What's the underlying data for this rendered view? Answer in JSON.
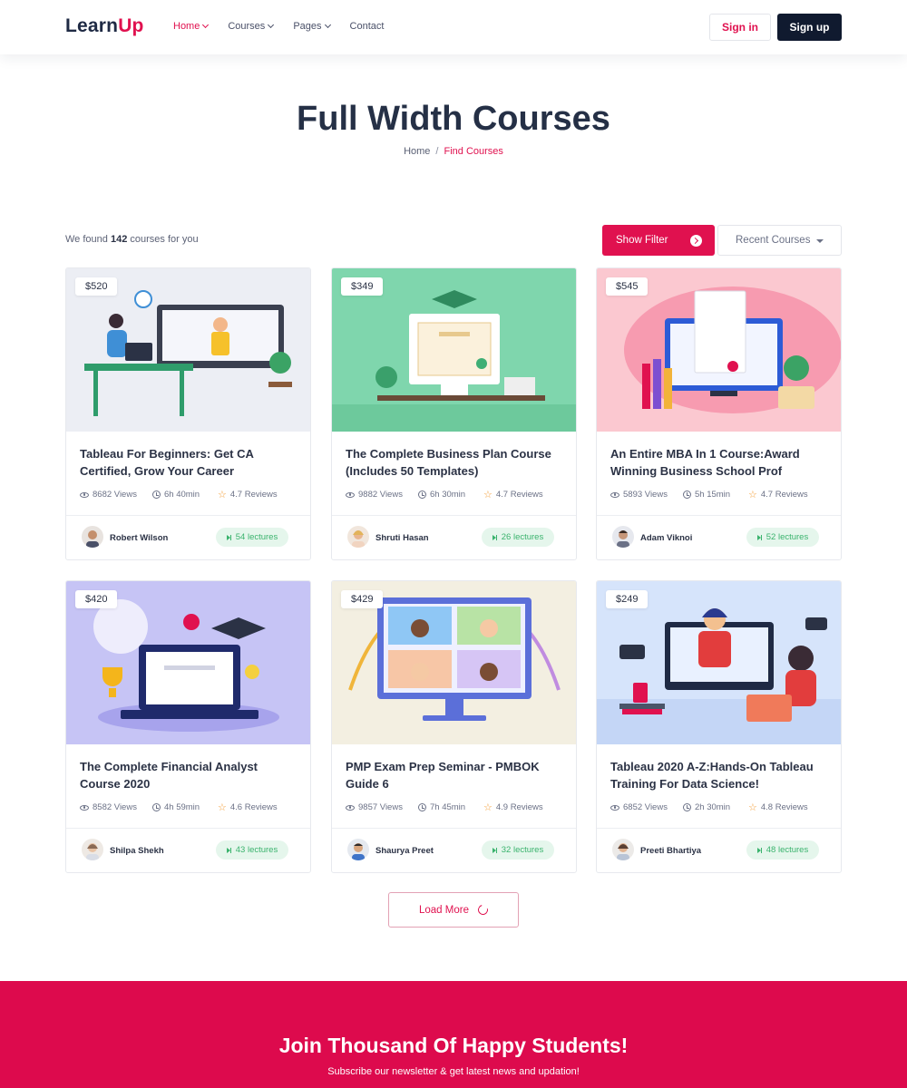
{
  "header": {
    "logo": {
      "part1": "Learn",
      "part2": "Up"
    },
    "nav": [
      {
        "label": "Home",
        "active": true,
        "dropdown": true
      },
      {
        "label": "Courses",
        "active": false,
        "dropdown": true
      },
      {
        "label": "Pages",
        "active": false,
        "dropdown": true
      },
      {
        "label": "Contact",
        "active": false,
        "dropdown": false
      }
    ],
    "signin_label": "Sign in",
    "signup_label": "Sign up"
  },
  "hero": {
    "title": "Full Width Courses",
    "breadcrumb": {
      "home": "Home",
      "separator": "/",
      "current": "Find Courses"
    }
  },
  "toolbar": {
    "found_prefix": "We found",
    "found_count": "142",
    "found_suffix": "courses for you",
    "filter_label": "Show Filter",
    "sort_label": "Recent Courses"
  },
  "courses": [
    {
      "price": "$520",
      "title": "Tableau For Beginners: Get CA Certified, Grow Your Career",
      "views": "8682 Views",
      "duration": "6h 40min",
      "reviews": "4.7 Reviews",
      "author": "Robert Wilson",
      "lectures": "54 lectures",
      "theme": "#eceef4"
    },
    {
      "price": "$349",
      "title": "The Complete Business Plan Course (Includes 50 Templates)",
      "views": "9882 Views",
      "duration": "6h 30min",
      "reviews": "4.7 Reviews",
      "author": "Shruti Hasan",
      "lectures": "26 lectures",
      "theme": "#7fd6ad"
    },
    {
      "price": "$545",
      "title": "An Entire MBA In 1 Course:Award Winning Business School Prof",
      "views": "5893 Views",
      "duration": "5h 15min",
      "reviews": "4.7 Reviews",
      "author": "Adam Viknoi",
      "lectures": "52 lectures",
      "theme": "#fbc8d0"
    },
    {
      "price": "$420",
      "title": "The Complete Financial Analyst Course 2020",
      "views": "8582 Views",
      "duration": "4h 59min",
      "reviews": "4.6 Reviews",
      "author": "Shilpa Shekh",
      "lectures": "43 lectures",
      "theme": "#c6c4f5"
    },
    {
      "price": "$429",
      "title": "PMP Exam Prep Seminar - PMBOK Guide 6",
      "views": "9857 Views",
      "duration": "7h 45min",
      "reviews": "4.9 Reviews",
      "author": "Shaurya Preet",
      "lectures": "32 lectures",
      "theme": "#f3efe1"
    },
    {
      "price": "$249",
      "title": "Tableau 2020 A-Z:Hands-On Tableau Training For Data Science!",
      "views": "6852 Views",
      "duration": "2h 30min",
      "reviews": "4.8 Reviews",
      "author": "Preeti Bhartiya",
      "lectures": "48 lectures",
      "theme": "#d6e4fb"
    }
  ],
  "load_more_label": "Load More",
  "newsletter": {
    "title": "Join Thousand Of Happy Students!",
    "subtitle": "Subscribe our newsletter & get latest news and updation!"
  },
  "colors": {
    "accent": "#e0114f",
    "dark": "#101a2f",
    "green": "#3ab36d",
    "star": "#f39c33"
  }
}
